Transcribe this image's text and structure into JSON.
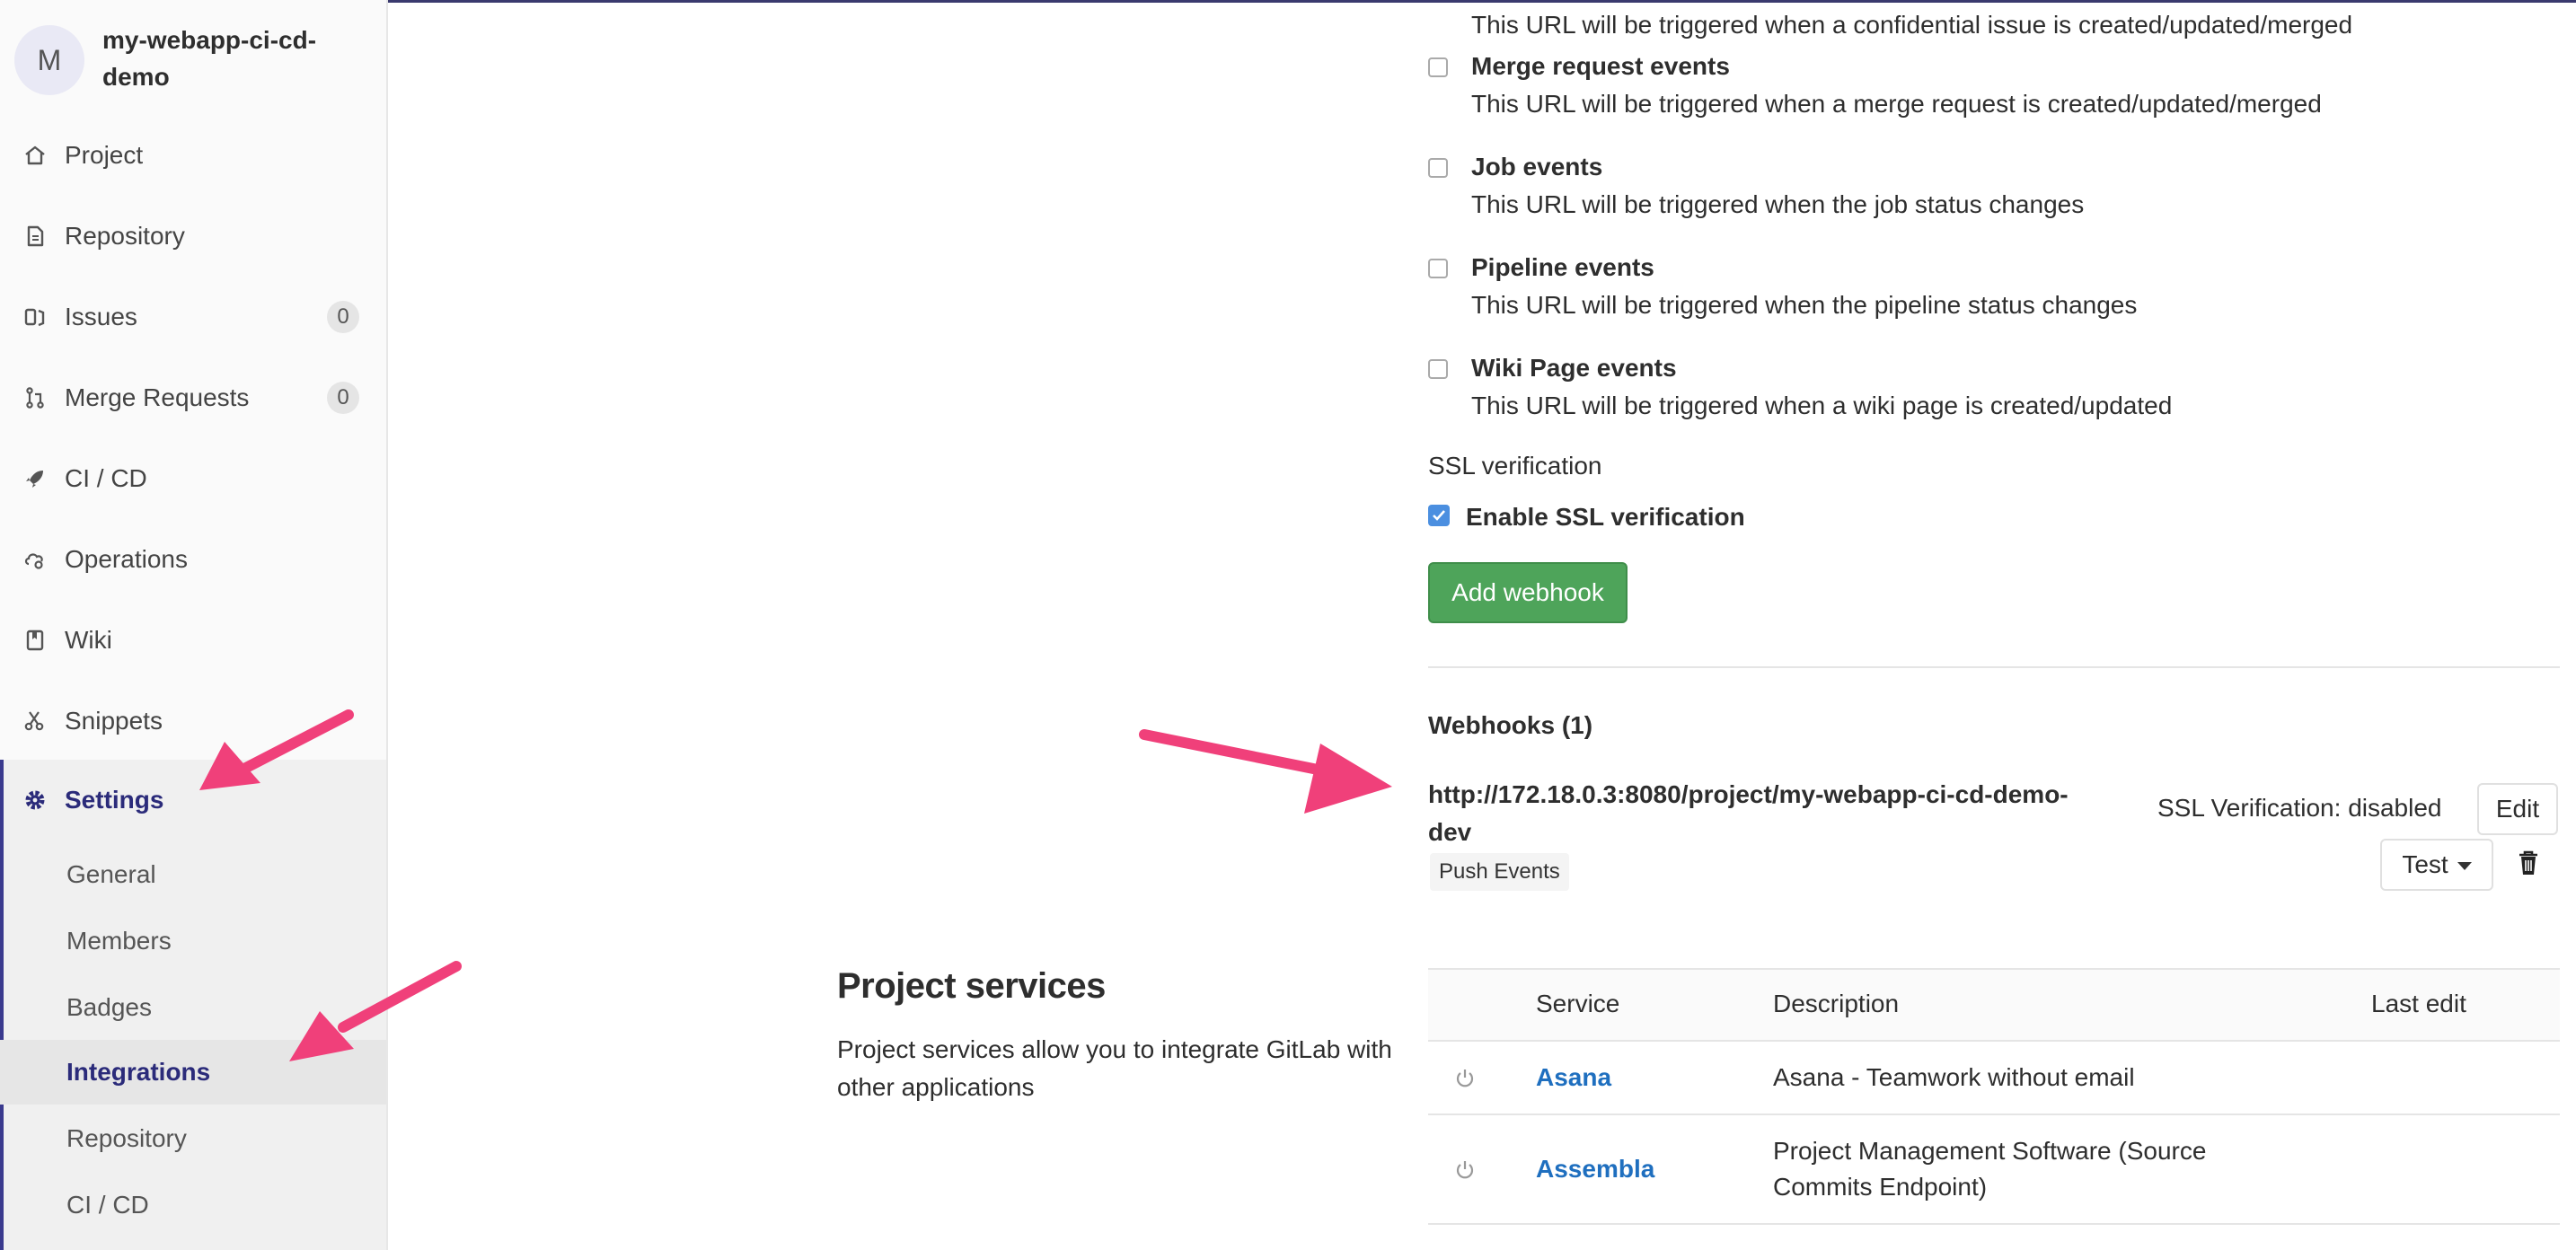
{
  "project": {
    "avatar_letter": "M",
    "name": "my-webapp-ci-cd-demo"
  },
  "sidebar": {
    "items": [
      {
        "label": "Project",
        "icon": "home-icon"
      },
      {
        "label": "Repository",
        "icon": "document-icon"
      },
      {
        "label": "Issues",
        "icon": "issues-icon",
        "count": "0"
      },
      {
        "label": "Merge Requests",
        "icon": "merge-request-icon",
        "count": "0"
      },
      {
        "label": "CI / CD",
        "icon": "rocket-icon"
      },
      {
        "label": "Operations",
        "icon": "cloud-gear-icon"
      },
      {
        "label": "Wiki",
        "icon": "book-icon"
      },
      {
        "label": "Snippets",
        "icon": "scissors-icon"
      },
      {
        "label": "Settings",
        "icon": "gear-icon"
      }
    ],
    "settings_sub": [
      "General",
      "Members",
      "Badges",
      "Integrations",
      "Repository",
      "CI / CD"
    ]
  },
  "events": [
    {
      "title": "Merge request events",
      "desc": "This URL will be triggered when a merge request is created/updated/merged"
    },
    {
      "title": "Job events",
      "desc": "This URL will be triggered when the job status changes"
    },
    {
      "title": "Pipeline events",
      "desc": "This URL will be triggered when the pipeline status changes"
    },
    {
      "title": "Wiki Page events",
      "desc": "This URL will be triggered when a wiki page is created/updated"
    }
  ],
  "partial_event_desc": "This URL will be triggered when a confidential issue is created/updated/merged",
  "ssl": {
    "heading": "SSL verification",
    "label": "Enable SSL verification",
    "checked": true
  },
  "add_webhook_label": "Add webhook",
  "webhooks": {
    "heading": "Webhooks (1)",
    "url": "http://172.18.0.3:8080/project/my-webapp-ci-cd-demo-dev",
    "badge": "Push Events",
    "ssl_status": "SSL Verification: disabled",
    "edit_label": "Edit",
    "test_label": "Test"
  },
  "project_services": {
    "title": "Project services",
    "description": "Project services allow you to integrate GitLab with other applications",
    "columns": [
      "Service",
      "Description",
      "Last edit"
    ],
    "rows": [
      {
        "name": "Asana",
        "description": "Asana - Teamwork without email"
      },
      {
        "name": "Assembla",
        "description": "Project Management Software (Source Commits Endpoint)"
      }
    ]
  },
  "colors": {
    "accent": "#2b2b7a",
    "add_button": "#4ea45a",
    "link": "#1f6fbf",
    "annotation_arrow": "#f0407a"
  }
}
